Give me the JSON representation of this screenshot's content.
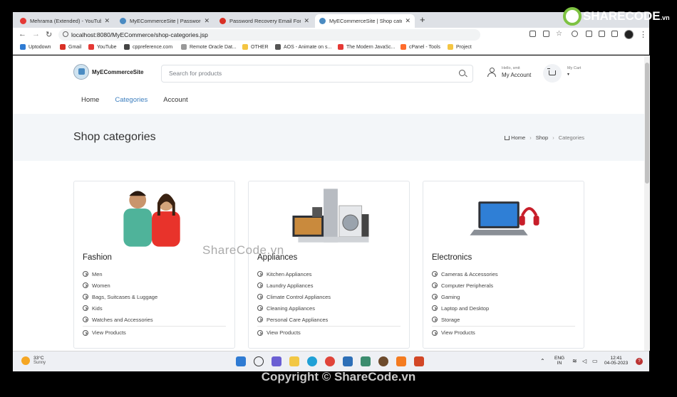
{
  "browser": {
    "tabs": [
      {
        "title": "Mehrama (Extended) - YouTube",
        "active": false,
        "color": "#e53935"
      },
      {
        "title": "MyECommerceSite | Password Re",
        "active": false,
        "color": "#4a8bc2"
      },
      {
        "title": "Password Recovery Email For My",
        "active": false,
        "color": "#d93025"
      },
      {
        "title": "MyECommerceSite | Shop catego",
        "active": true,
        "color": "#4a8bc2"
      }
    ],
    "new_tab": "+",
    "url": "localhost:8080/MyECommerce/shop-categories.jsp",
    "bookmarks": [
      {
        "label": "Uptodown",
        "color": "#2f7bd3"
      },
      {
        "label": "Gmail",
        "color": "#d93025"
      },
      {
        "label": "YouTube",
        "color": "#e53935"
      },
      {
        "label": "cppreference.com",
        "color": "#444444"
      },
      {
        "label": "Remote Oracle Dat...",
        "color": "#999999"
      },
      {
        "label": "OTHER",
        "color": "#f4c542"
      },
      {
        "label": "AOS - Animate on s...",
        "color": "#555555"
      },
      {
        "label": "The Modern JavaSc...",
        "color": "#e53935"
      },
      {
        "label": "cPanel - Tools",
        "color": "#ff6c2c"
      },
      {
        "label": "Project",
        "color": "#f4c542"
      }
    ]
  },
  "site": {
    "logo_text": "MyECommerceSite",
    "search_placeholder": "Search for products",
    "account_small": "Hello, smit",
    "account_big": "My Account",
    "cart_small": "My Cart",
    "cart_caret": "▾",
    "nav": [
      "Home",
      "Categories",
      "Account"
    ]
  },
  "hero": {
    "title": "Shop categories",
    "breadcrumb": [
      "Home",
      "Shop",
      "Categories"
    ]
  },
  "categories": [
    {
      "title": "Fashion",
      "items": [
        "Men",
        "Women",
        "Bags, Suitcases & Luggage",
        "Kids",
        "Watches and Accessories"
      ],
      "link": "View Products"
    },
    {
      "title": "Appliances",
      "items": [
        "Kitchen Appliances",
        "Laundry Appliances",
        "Climate Control Appliances",
        "Cleaning Appliances",
        "Personal Care Appliances"
      ],
      "link": "View Products"
    },
    {
      "title": "Electronics",
      "items": [
        "Cameras & Accessories",
        "Computer Peripherals",
        "Gaming",
        "Laptop and Desktop",
        "Storage"
      ],
      "link": "View Products"
    }
  ],
  "taskbar": {
    "temp": "33°C",
    "weather": "Sunny",
    "lang1": "ENG",
    "lang2": "IN",
    "time": "12:41",
    "date": "04-05-2023"
  },
  "overlay": {
    "brand": "SHARECODE",
    "brand_suffix": ".vn",
    "watermark": "ShareCode.vn",
    "copyright": "Copyright © ShareCode.vn"
  },
  "colors": {
    "accent": "#3d7fbf",
    "hero_bg": "#f3f6f9",
    "brand_green": "#7ec242"
  }
}
